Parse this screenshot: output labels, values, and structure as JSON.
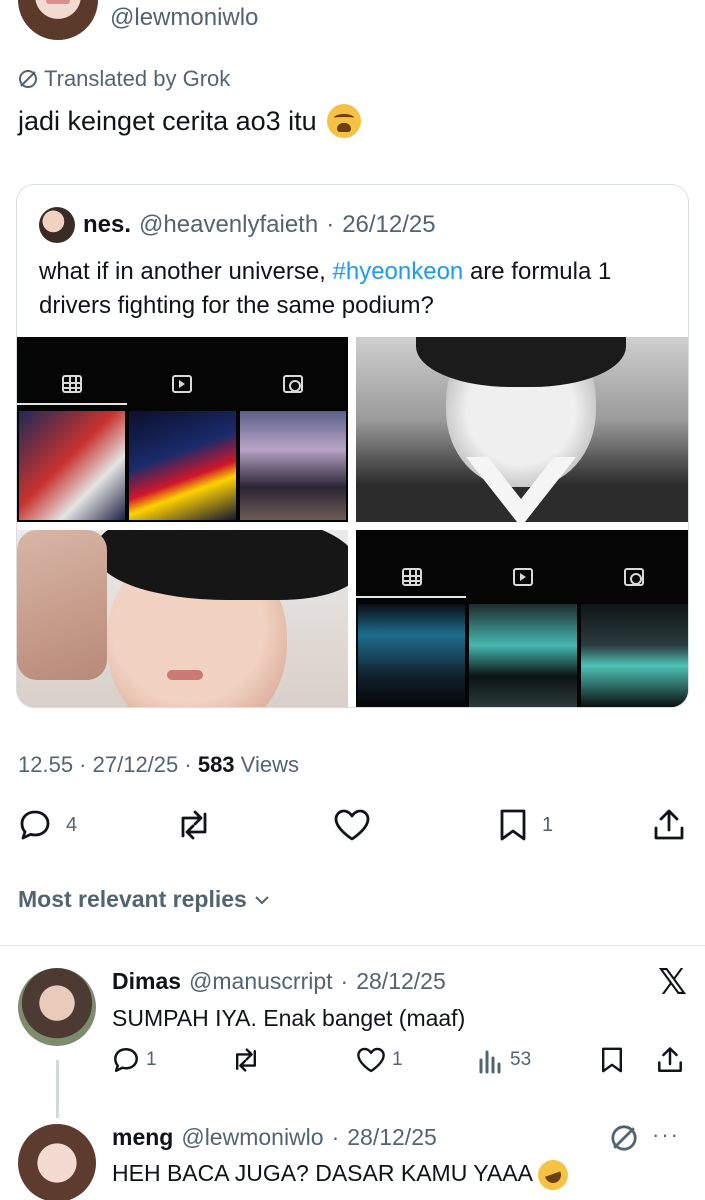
{
  "tweet": {
    "handle": "@lewmoniwlo",
    "translated_label": "Translated by Grok",
    "text": "jadi keinget cerita ao3 itu",
    "emoji": "weary-face",
    "timestamp": "12.55",
    "date": "27/12/25",
    "views_count": "583",
    "views_label": "Views"
  },
  "quote": {
    "name": "nes.",
    "handle": "@heavenlyfaieth",
    "date": "26/12/25",
    "text_before": "what if in another universe, ",
    "hashtag": "#hyeonkeon",
    "text_after": " are formula 1 drivers fighting for the same podium?"
  },
  "actions": {
    "replies": "4",
    "retweets": "",
    "likes": "",
    "bookmarks": "1"
  },
  "replies_header": "Most relevant replies",
  "replies": [
    {
      "name": "Dimas",
      "handle": "@manuscrript",
      "date": "28/12/25",
      "text": "SUMPAH IYA. Enak banget (maaf)",
      "reply_count": "1",
      "like_count": "1",
      "views": "53"
    },
    {
      "name": "meng",
      "handle": "@lewmoniwlo",
      "date": "28/12/25",
      "text": "HEH BACA JUGA? DASAR KAMU YAAA"
    }
  ],
  "colors": {
    "text": "#0f1419",
    "muted": "#536471",
    "link": "#1d9bf0",
    "border": "#d8dee3"
  },
  "icons": [
    "grok-icon",
    "reply-icon",
    "retweet-icon",
    "like-icon",
    "bookmark-icon",
    "share-icon",
    "views-icon",
    "x-logo-icon",
    "chevron-down-icon",
    "more-icon"
  ]
}
